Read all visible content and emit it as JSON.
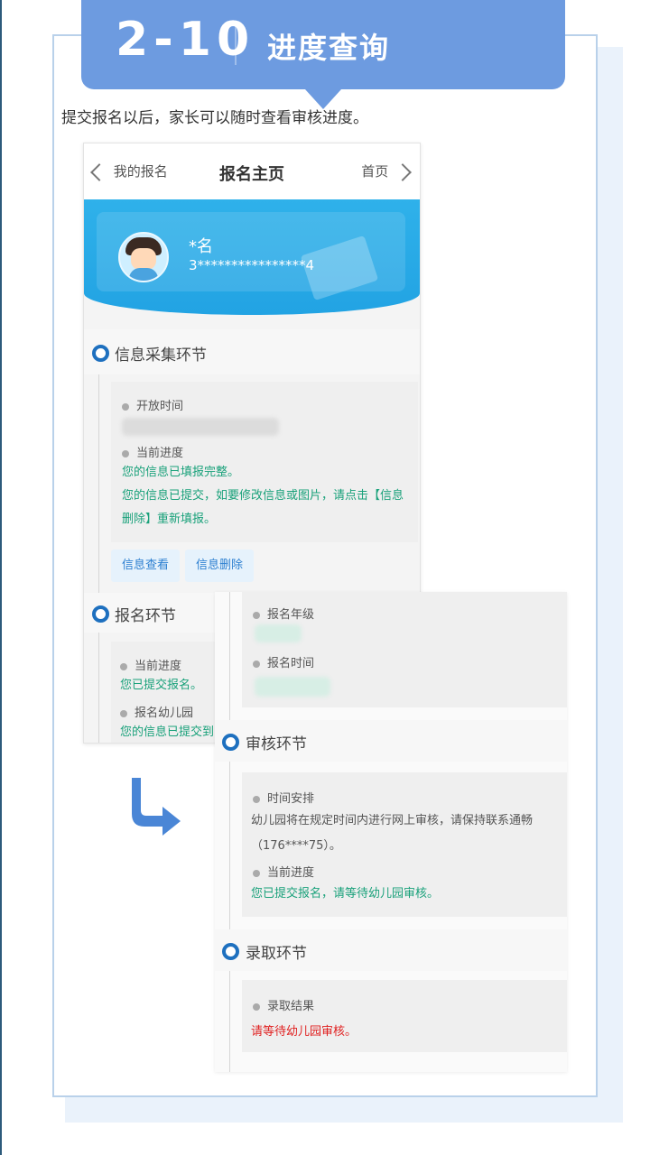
{
  "banner": {
    "number": "2-10",
    "title": "进度查询"
  },
  "intro": "提交报名以后，家长可以随时查看审核进度。",
  "phone": {
    "nav": {
      "back": "我的报名",
      "title": "报名主页",
      "home": "首页"
    },
    "profile": {
      "name": "*名",
      "id": "3****************4"
    },
    "info_section": {
      "title": "信息采集环节",
      "open_time_label": "开放时间",
      "progress_label": "当前进度",
      "status1": "您的信息已填报完整。",
      "status2_line1": "您的信息已提交，如要修改信息或图片，请点击【信息",
      "status2_line2": "删除】重新填报。",
      "buttons": [
        "信息查看",
        "信息删除"
      ]
    },
    "signup_section": {
      "title": "报名环节",
      "progress_label": "当前进度",
      "progress_value": "您已提交报名。",
      "kindergarten_label": "报名幼儿园",
      "kindergarten_value": "您的信息已提交到"
    }
  },
  "detail": {
    "grade_label": "报名年级",
    "time_label": "报名时间",
    "review_section": {
      "title": "审核环节",
      "schedule_label": "时间安排",
      "schedule_line1": "幼儿园将在规定时间内进行网上审核，请保持联系通畅",
      "schedule_line2": "（176****75）。",
      "progress_label": "当前进度",
      "progress_value": "您已提交报名，请等待幼儿园审核。"
    },
    "admission_section": {
      "title": "录取环节",
      "result_label": "录取结果",
      "result_value": "请等待幼儿园审核。"
    }
  },
  "colors": {
    "banner": "#6d9be0",
    "green_text": "#19a17a",
    "red_text": "#e02020",
    "section_dot": "#1e70bf",
    "hero": "#2fb1ea"
  }
}
